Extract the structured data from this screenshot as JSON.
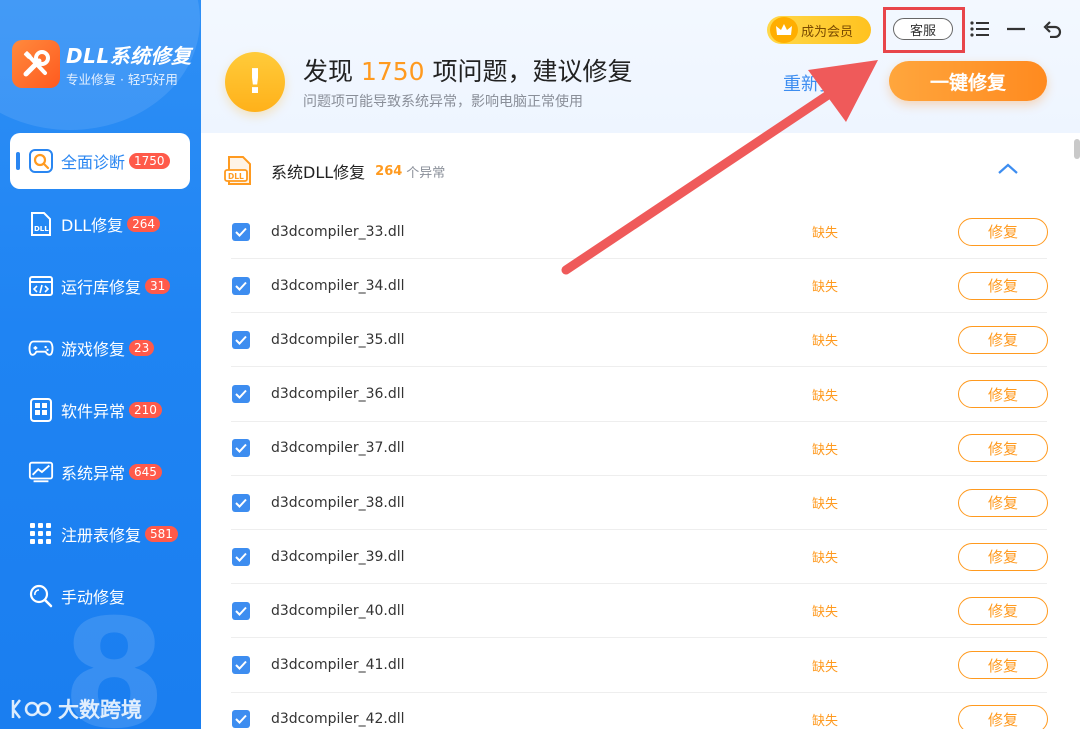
{
  "app": {
    "title": "DLL系统修复",
    "subtitle": "专业修复 · 轻巧好用"
  },
  "sidebar": {
    "items": [
      {
        "label": "全面诊断",
        "badge": "1750",
        "icon": "search-icon",
        "active": true
      },
      {
        "label": "DLL修复",
        "badge": "264",
        "icon": "dll-file-icon"
      },
      {
        "label": "运行库修复",
        "badge": "31",
        "icon": "code-window-icon"
      },
      {
        "label": "游戏修复",
        "badge": "23",
        "icon": "gamepad-icon"
      },
      {
        "label": "软件异常",
        "badge": "210",
        "icon": "apps-grid-icon"
      },
      {
        "label": "系统异常",
        "badge": "645",
        "icon": "monitor-chart-icon"
      },
      {
        "label": "注册表修复",
        "badge": "581",
        "icon": "registry-grid-icon"
      },
      {
        "label": "手动修复",
        "badge": "",
        "icon": "magnifier-icon"
      }
    ],
    "big_number": "8",
    "watermark": "大数跨境"
  },
  "header": {
    "title_prefix": "发现",
    "issue_count": "1750",
    "title_suffix": "项问题，建议修复",
    "subtitle": "问题项可能导致系统异常，影响电脑正常使用",
    "vip_label": "成为会员",
    "support_label": "客服",
    "rescan_label": "重新扫描",
    "fix_all_label": "一键修复"
  },
  "section": {
    "title": "系统DLL修复",
    "count": "264",
    "count_unit": "个异常"
  },
  "rows": [
    {
      "name": "d3dcompiler_33.dll",
      "status": "缺失",
      "action": "修复"
    },
    {
      "name": "d3dcompiler_34.dll",
      "status": "缺失",
      "action": "修复"
    },
    {
      "name": "d3dcompiler_35.dll",
      "status": "缺失",
      "action": "修复"
    },
    {
      "name": "d3dcompiler_36.dll",
      "status": "缺失",
      "action": "修复"
    },
    {
      "name": "d3dcompiler_37.dll",
      "status": "缺失",
      "action": "修复"
    },
    {
      "name": "d3dcompiler_38.dll",
      "status": "缺失",
      "action": "修复"
    },
    {
      "name": "d3dcompiler_39.dll",
      "status": "缺失",
      "action": "修复"
    },
    {
      "name": "d3dcompiler_40.dll",
      "status": "缺失",
      "action": "修复"
    },
    {
      "name": "d3dcompiler_41.dll",
      "status": "缺失",
      "action": "修复"
    },
    {
      "name": "d3dcompiler_42.dll",
      "status": "缺失",
      "action": "修复"
    }
  ],
  "colors": {
    "sidebar_blue": "#1f84f3",
    "accent_orange": "#ff9a1f",
    "highlight_red": "#e8454a",
    "badge_red": "#ff5a4a"
  }
}
